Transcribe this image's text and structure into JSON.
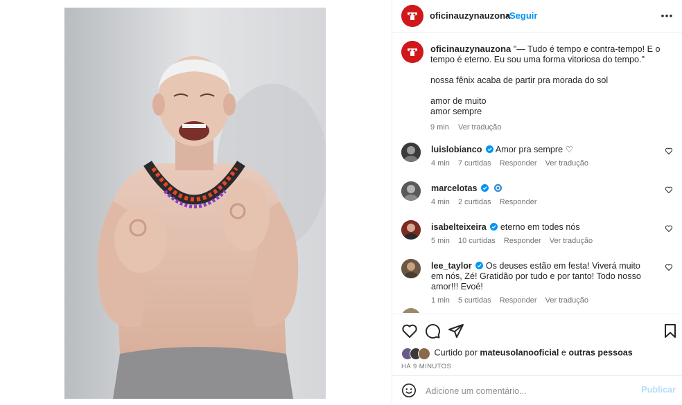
{
  "post": {
    "username": "oficinauzynauzona",
    "follow_label": "Seguir",
    "dot": "•",
    "image_alt": "Photo of a smiling shirtless elderly man wearing a colorful beaded necklace making OK hand gestures"
  },
  "caption": {
    "username": "oficinauzynauzona",
    "line1": "\"— Tudo é tempo e contra-tempo! E o tempo é eterno. Eu sou uma forma vitoriosa do tempo.\"",
    "line2": "nossa fênix acaba de partir pra morada do sol",
    "line3": "amor de muito",
    "line4": "amor sempre",
    "time": "9 min",
    "translate": "Ver tradução"
  },
  "comments": [
    {
      "username": "luislobianco",
      "text": "Amor pra sempre ♡",
      "time": "4 min",
      "likes": "7 curtidas",
      "reply": "Responder",
      "translate": "Ver tradução"
    },
    {
      "username": "marcelotas",
      "text": "",
      "time": "4 min",
      "likes": "2 curtidas",
      "reply": "Responder",
      "translate": ""
    },
    {
      "username": "isabelteixeira",
      "text": "eterno em todes nós",
      "time": "5 min",
      "likes": "10 curtidas",
      "reply": "Responder",
      "translate": "Ver tradução"
    },
    {
      "username": "lee_taylor",
      "text": "Os deuses estão em festa! Viverá muito em nós, Zé! Gratidão por tudo e por tanto! Todo nosso amor!!! Evoé!",
      "time": "1 min",
      "likes": "5 curtidas",
      "reply": "Responder",
      "translate": "Ver tradução"
    }
  ],
  "footer": {
    "liked_prefix": "Curtido por",
    "liked_user": "mateusolanooficial",
    "liked_and": "e",
    "liked_others": "outras pessoas",
    "time_ago": "HÁ 9 MINUTOS",
    "comment_placeholder": "Adicione um comentário...",
    "publish_label": "Publicar"
  },
  "colors": {
    "accent": "#0095f6",
    "brand_red": "#d0181c",
    "muted_text": "#737373",
    "publish_disabled": "#b2dffc"
  },
  "icons": {
    "more": "more-horizontal-icon",
    "heart": "heart-icon",
    "comment": "comment-icon",
    "share": "share-icon",
    "save": "bookmark-icon",
    "emoji": "emoji-icon",
    "verified": "verified-badge-icon"
  }
}
